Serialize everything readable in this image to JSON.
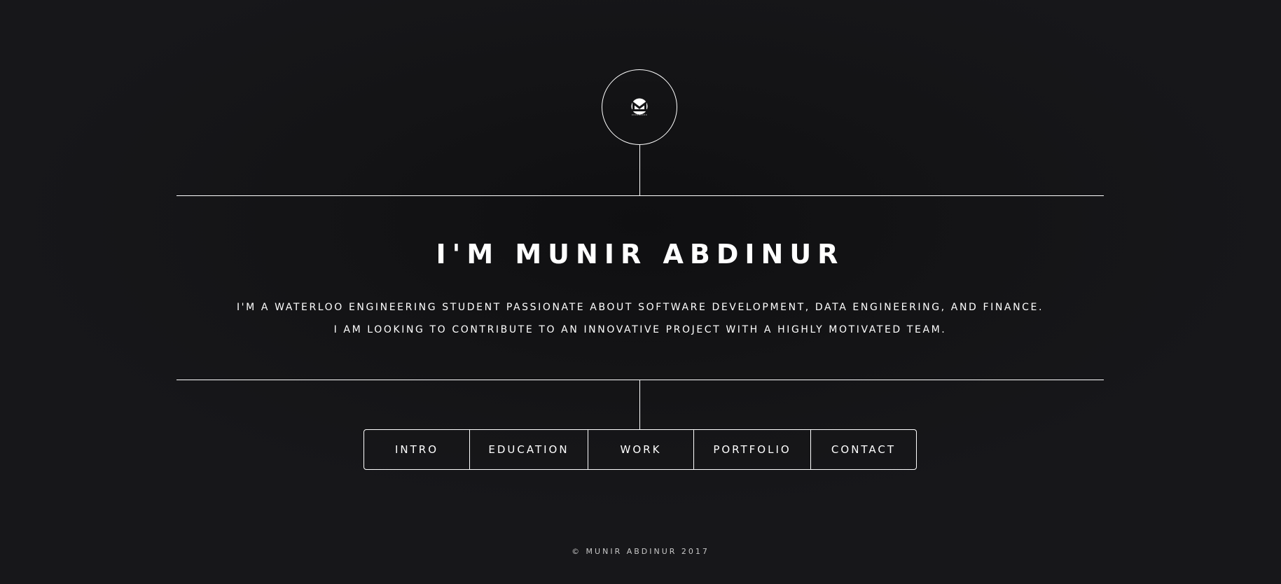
{
  "header": {
    "logo_icon": "monero-logo-icon"
  },
  "hero": {
    "title": "I'M MUNIR ABDINUR",
    "subtitle_line1": "I'M A WATERLOO ENGINEERING STUDENT PASSIONATE ABOUT SOFTWARE DEVELOPMENT,  DATA ENGINEERING, AND FINANCE.",
    "subtitle_line2": "I AM LOOKING TO CONTRIBUTE TO AN INNOVATIVE PROJECT WITH A HIGHLY MOTIVATED TEAM."
  },
  "nav": {
    "items": [
      {
        "label": "INTRO"
      },
      {
        "label": "EDUCATION"
      },
      {
        "label": "WORK"
      },
      {
        "label": "PORTFOLIO"
      },
      {
        "label": "CONTACT"
      }
    ]
  },
  "footer": {
    "copyright": "© MUNIR ABDINUR 2017"
  },
  "colors": {
    "background": "#141416",
    "foreground": "#ffffff"
  }
}
